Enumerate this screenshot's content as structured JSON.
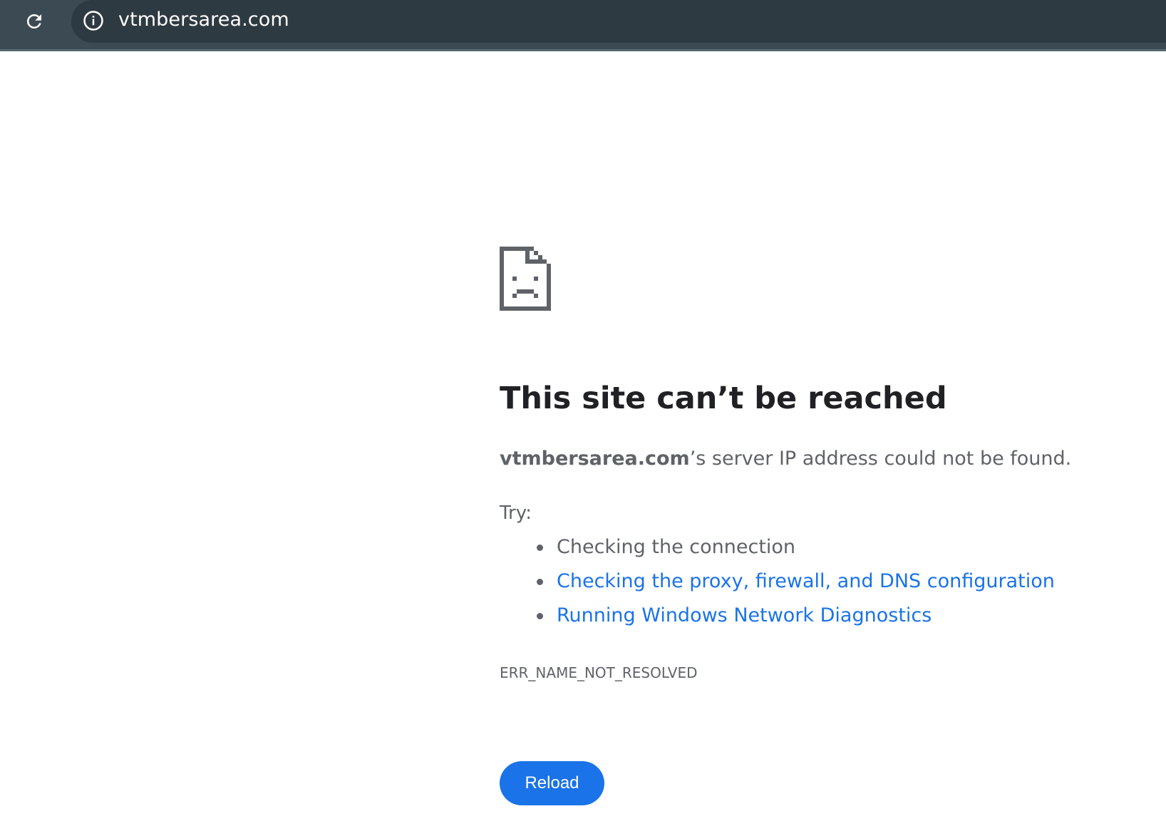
{
  "browser": {
    "url": "vtmbersarea.com",
    "reload_icon": "reload-icon",
    "site_info_icon": "info-icon"
  },
  "error_page": {
    "icon": "sad-page-icon",
    "title": "This site can’t be reached",
    "message_host": "vtmbersarea.com",
    "message_rest": "’s server IP address could not be found.",
    "try_label": "Try:",
    "suggestions": [
      {
        "label": "Checking the connection",
        "is_link": false
      },
      {
        "label": "Checking the proxy, firewall, and DNS configuration",
        "is_link": true
      },
      {
        "label": "Running Windows Network Diagnostics",
        "is_link": true
      }
    ],
    "error_code": "ERR_NAME_NOT_RESOLVED",
    "reload_button_label": "Reload"
  },
  "colors": {
    "toolbar_bg": "#3c4a54",
    "link": "#1a73e8",
    "button_bg": "#1a73e8",
    "text_primary": "#202124",
    "text_secondary": "#5f6368"
  }
}
